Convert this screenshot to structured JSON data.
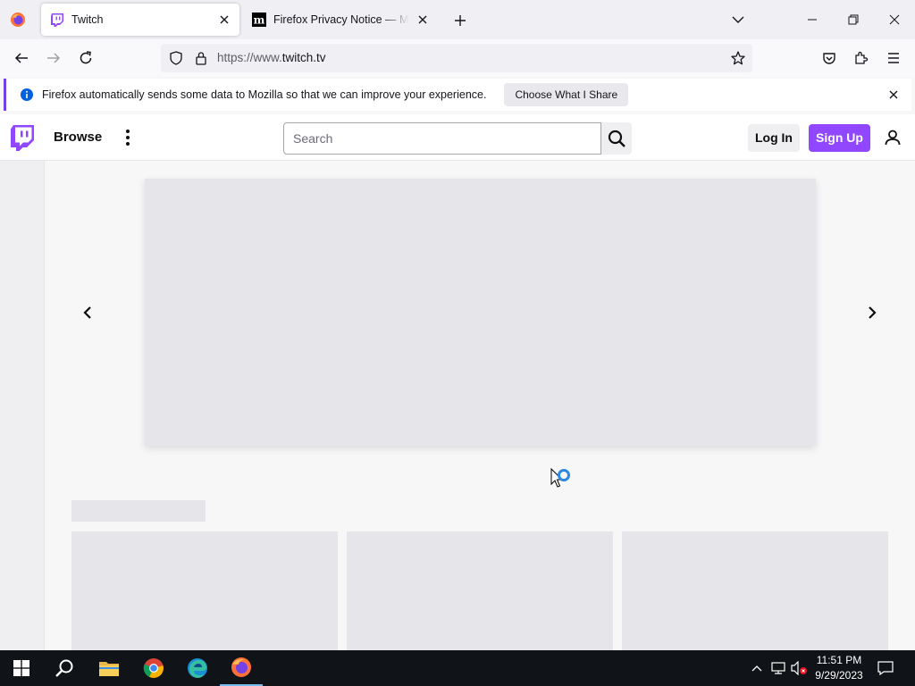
{
  "browser": {
    "tabs": [
      {
        "title": "Twitch",
        "active": true,
        "favicon": "twitch-icon"
      },
      {
        "title": "Firefox Privacy Notice — Mozilla",
        "active": false,
        "favicon": "mozilla-icon"
      }
    ],
    "url_prefix": "https://www.",
    "url_host": "twitch.tv",
    "notification": {
      "message": "Firefox automatically sends some data to Mozilla so that we can improve your experience.",
      "button": "Choose What I Share"
    }
  },
  "twitch": {
    "nav": {
      "browse": "Browse"
    },
    "search": {
      "placeholder": "Search"
    },
    "auth": {
      "login": "Log In",
      "signup": "Sign Up"
    },
    "brand_color": "#9146ff"
  },
  "taskbar": {
    "time": "11:51 PM",
    "date": "9/29/2023",
    "pinned": [
      "start-icon",
      "search-icon",
      "file-explorer-icon",
      "chrome-icon",
      "edge-icon",
      "firefox-icon"
    ]
  }
}
